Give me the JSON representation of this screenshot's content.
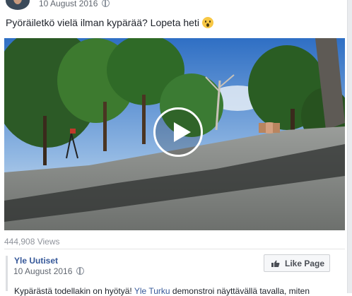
{
  "post": {
    "date": "10 August 2016",
    "headline": "Pyöräiletkö vielä ilman kypärää? Lopeta heti"
  },
  "video": {
    "views": "444,908 Views"
  },
  "shared_from": {
    "page_name": "Yle Uutiset",
    "date": "10 August 2016",
    "like_button_label": "Like Page",
    "description_prefix": "Kypärästä todellakin on hyötyä! ",
    "description_link": "Yle Turku",
    "description_suffix": " demonstroi näyttävällä tavalla, miten"
  },
  "colors": {
    "link": "#365899",
    "meta_text": "#616770",
    "views_text": "#90949c"
  }
}
